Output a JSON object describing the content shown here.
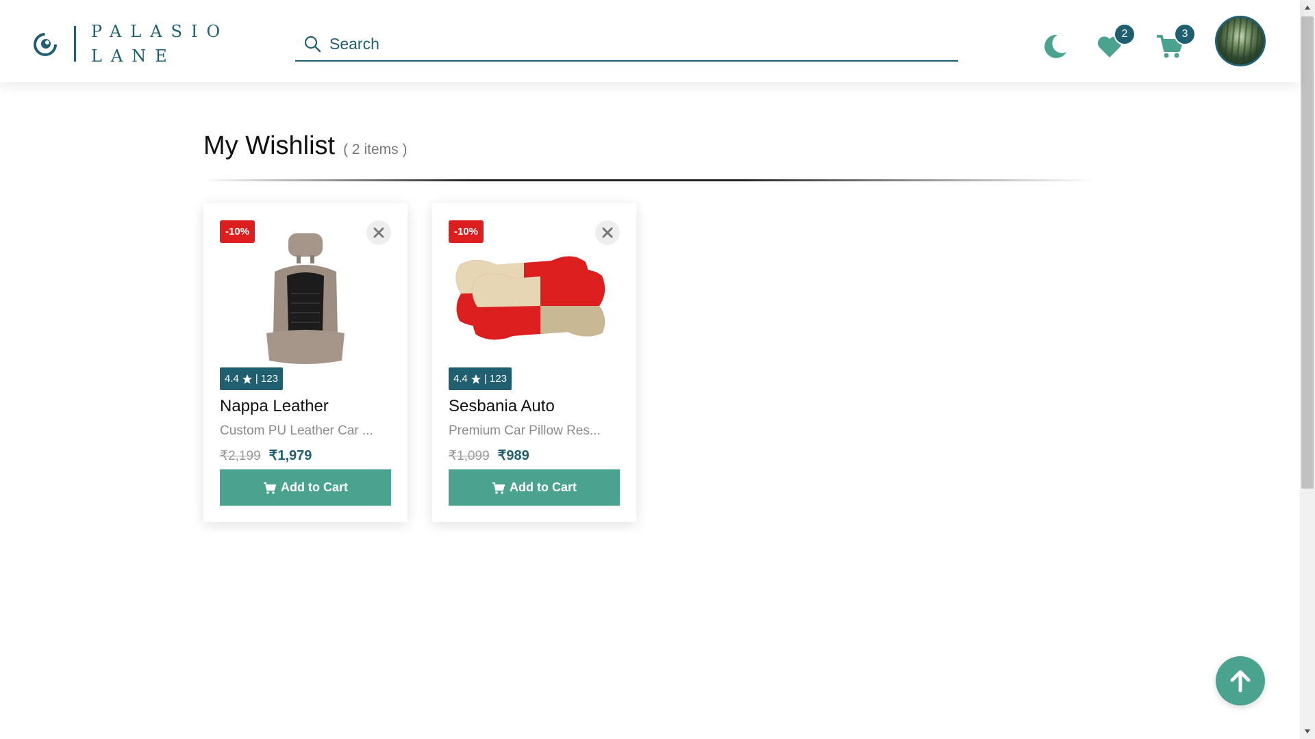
{
  "brand": {
    "line1": "PALASIO",
    "line2": "LANE",
    "color": "#1f5f6f"
  },
  "search": {
    "placeholder": "Search",
    "icon": "search-icon"
  },
  "header": {
    "wishlist_count": "2",
    "cart_count": "3",
    "icons": [
      "moon-icon",
      "heart-icon",
      "cart-icon",
      "avatar"
    ]
  },
  "page": {
    "title": "My Wishlist",
    "item_count": "( 2 items )"
  },
  "products": [
    {
      "discount": "-10%",
      "rating": "4.4",
      "reviews": "| 123",
      "name": "Nappa Leather",
      "description": "Custom PU Leather Car ...",
      "old_price": "₹2,199",
      "new_price": "₹1,979",
      "add_label": "Add to Cart"
    },
    {
      "discount": "-10%",
      "rating": "4.4",
      "reviews": "| 123",
      "name": "Sesbania Auto",
      "description": "Premium Car Pillow Res...",
      "old_price": "₹1,099",
      "new_price": "₹989",
      "add_label": "Add to Cart"
    }
  ],
  "colors": {
    "accent": "#4aa38f",
    "primary": "#1f5f6f",
    "discount": "#dc1e1e"
  }
}
